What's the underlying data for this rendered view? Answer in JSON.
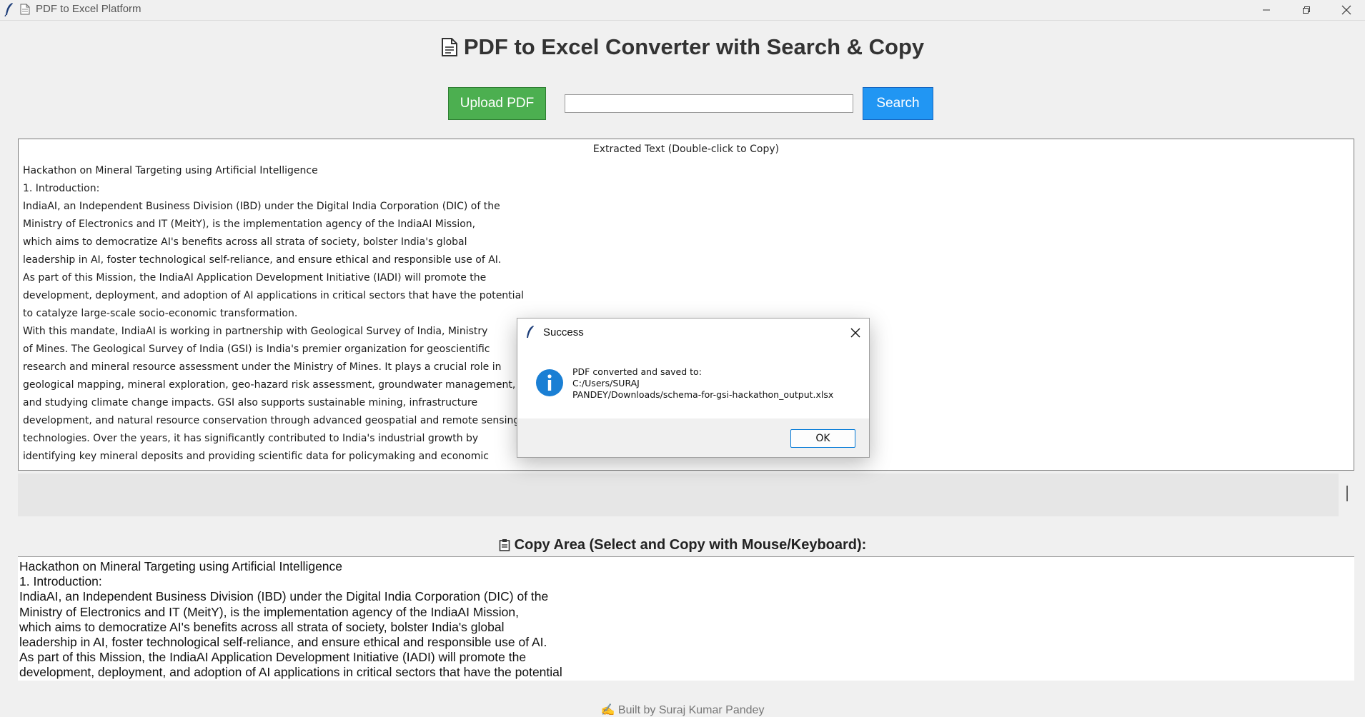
{
  "window": {
    "title": "PDF to Excel Platform"
  },
  "header": {
    "title": "PDF to Excel Converter with Search & Copy"
  },
  "toolbar": {
    "upload_label": "Upload PDF",
    "search_value": "",
    "search_placeholder": "",
    "search_label": "Search",
    "upload_color": "#4caf50",
    "search_color": "#2196f3"
  },
  "extracted": {
    "header": "Extracted Text (Double-click to Copy)",
    "lines": [
      "Hackathon on Mineral Targeting using Artificial Intelligence",
      "1. Introduction:",
      "IndiaAI, an Independent Business Division (IBD) under the Digital India Corporation (DIC) of the",
      "Ministry of Electronics and IT (MeitY), is the implementation agency of the IndiaAI Mission,",
      "which aims to democratize AI's benefits across all strata of society, bolster India's global",
      "leadership in AI, foster technological self-reliance, and ensure ethical and responsible use of AI.",
      "As part of this Mission, the IndiaAI Application Development Initiative (IADI) will promote the",
      "development, deployment, and adoption of AI applications in critical sectors that have the potential",
      "to catalyze large-scale socio-economic transformation.",
      "With this mandate, IndiaAI is working in partnership with Geological Survey of India, Ministry",
      "of Mines. The Geological Survey of India (GSI) is India's premier organization for geoscientific",
      "research and mineral resource assessment under the Ministry of Mines. It plays a crucial role in",
      "geological mapping, mineral exploration, geo-hazard risk assessment, groundwater management,",
      "and studying climate change impacts. GSI also supports sustainable mining, infrastructure",
      "development, and natural resource conservation through advanced geospatial and remote sensing",
      "technologies. Over the years, it has significantly contributed to India's industrial growth by",
      "identifying key mineral deposits and providing scientific data for policymaking and economic"
    ]
  },
  "copy_area": {
    "heading": "Copy Area (Select and Copy with Mouse/Keyboard):",
    "lines": [
      "Hackathon on Mineral Targeting using Artificial Intelligence",
      "1. Introduction:",
      "IndiaAI, an Independent Business Division (IBD) under the Digital India Corporation (DIC) of the",
      "Ministry of Electronics and IT (MeitY), is the implementation agency of the IndiaAI Mission,",
      "which aims to democratize AI's benefits across all strata of society, bolster India's global",
      "leadership in AI, foster technological self-reliance, and ensure ethical and responsible use of AI.",
      "As part of this Mission, the IndiaAI Application Development Initiative (IADI) will promote the",
      "development, deployment, and adoption of AI applications in critical sectors that have the potential"
    ]
  },
  "footer": {
    "text": "✍ Built by Suraj Kumar Pandey"
  },
  "dialog": {
    "title": "Success",
    "message_lines": [
      "PDF converted and saved to:",
      "C:/Users/SURAJ",
      "PANDEY/Downloads/schema-for-gsi-hackathon_output.xlsx"
    ],
    "ok_label": "OK",
    "icon": "info-icon",
    "icon_color": "#1a7fd4"
  }
}
